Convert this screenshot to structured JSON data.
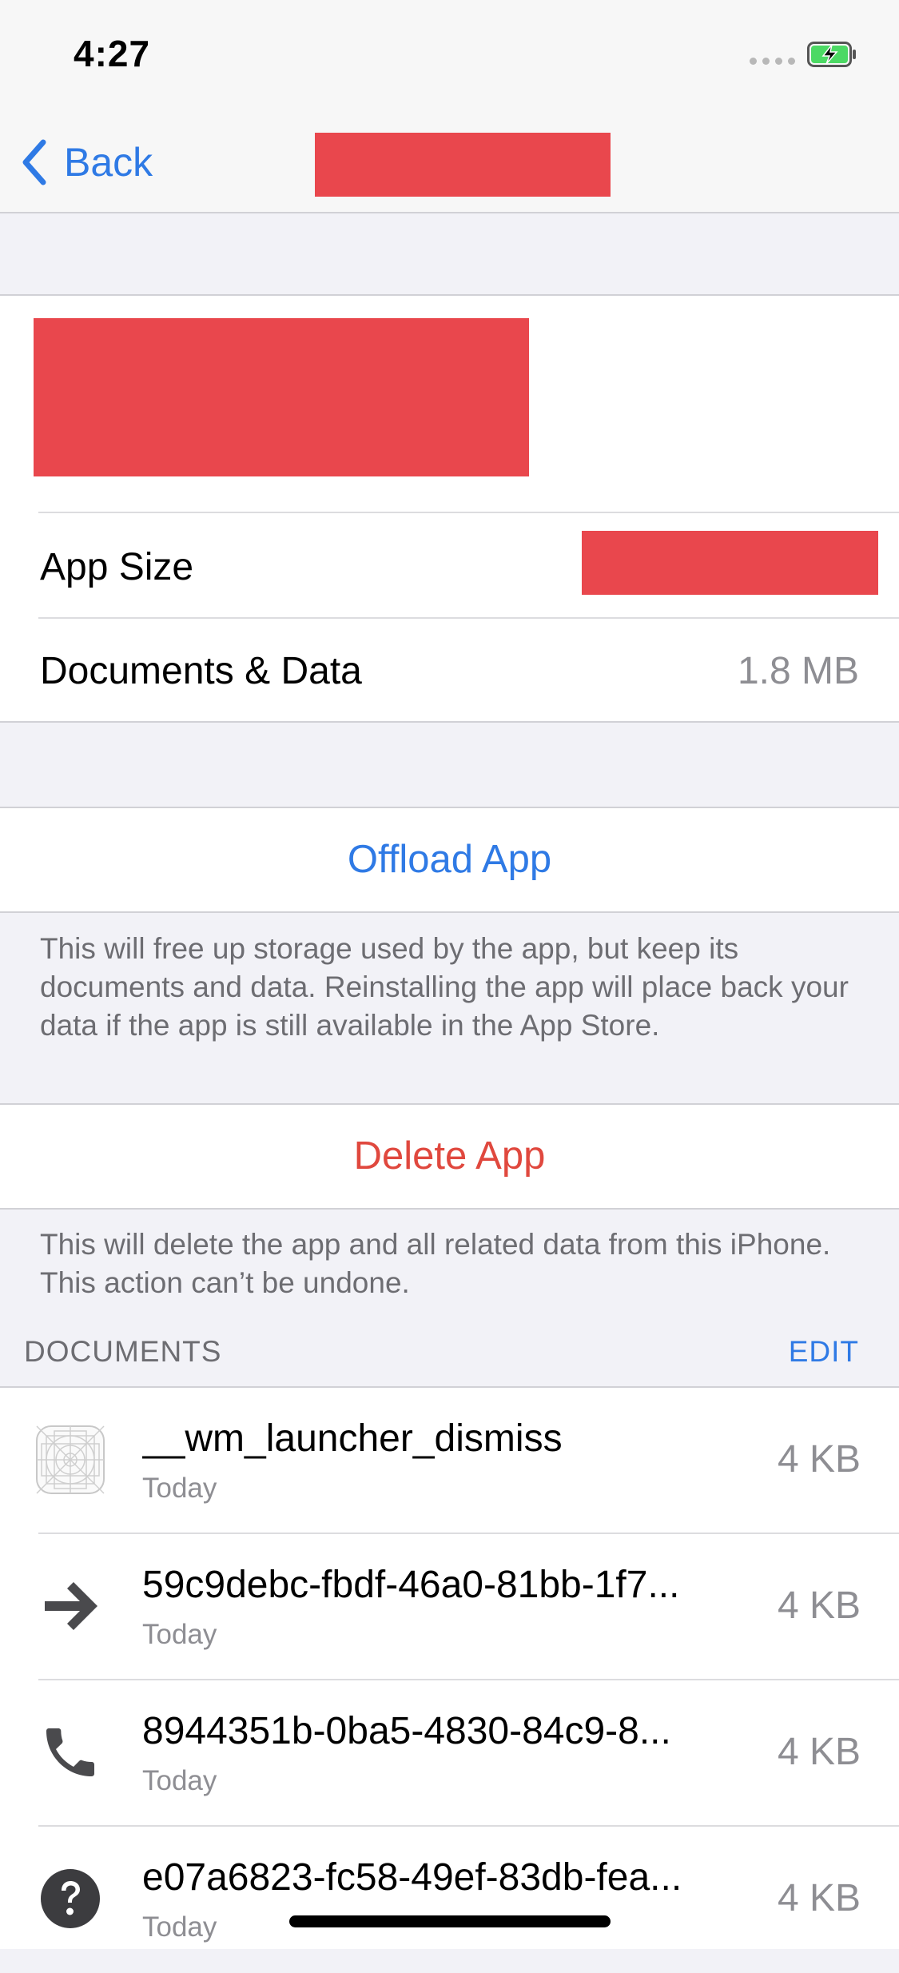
{
  "status_bar": {
    "time": "4:27",
    "battery_color": "#4cd964"
  },
  "nav": {
    "back_label": "Back"
  },
  "info": {
    "app_size_label": "App Size",
    "documents_data_label": "Documents & Data",
    "documents_data_value": "1.8 MB"
  },
  "offload": {
    "label": "Offload App",
    "footer": "This will free up storage used by the app, but keep its documents and data. Reinstalling the app will place back your data if the app is still available in the App Store."
  },
  "delete": {
    "label": "Delete App",
    "footer": "This will delete the app and all related data from this iPhone. This action can’t be undone."
  },
  "documents": {
    "header": "DOCUMENTS",
    "edit_label": "EDIT",
    "items": [
      {
        "name": "__wm_launcher_dismiss",
        "date": "Today",
        "size": "4 KB",
        "icon": "app-placeholder-icon"
      },
      {
        "name": "59c9debc-fbdf-46a0-81bb-1f7...",
        "date": "Today",
        "size": "4 KB",
        "icon": "arrow-right-icon"
      },
      {
        "name": "8944351b-0ba5-4830-84c9-8...",
        "date": "Today",
        "size": "4 KB",
        "icon": "phone-icon"
      },
      {
        "name": "e07a6823-fc58-49ef-83db-fea...",
        "date": "Today",
        "size": "4 KB",
        "icon": "question-icon"
      }
    ]
  },
  "colors": {
    "accent": "#2f7ae5",
    "destructive": "#e0483e",
    "redaction": "#e9474d"
  }
}
